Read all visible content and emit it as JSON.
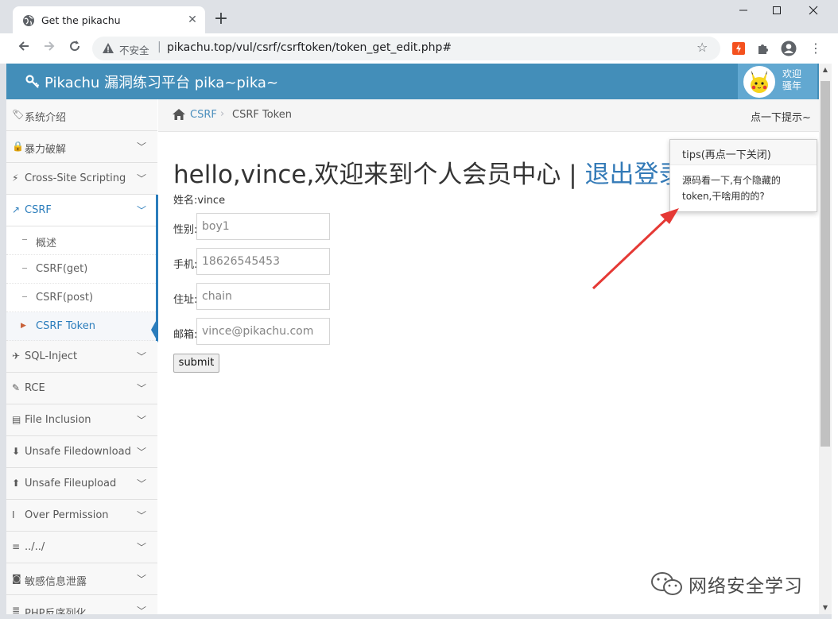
{
  "browser": {
    "tab_title": "Get the pikachu",
    "tab_close": "✕",
    "new_tab": "+",
    "insecure_label": "不安全",
    "url": "pikachu.top/vul/csrf/csrftoken/token_get_edit.php#"
  },
  "header": {
    "brand": "Pikachu 漏洞练习平台 pika~pika~",
    "welcome": "欢迎骚年"
  },
  "sidebar": {
    "items": [
      {
        "label": "系统介绍",
        "icon": "tags-icon",
        "glyph": "🏷"
      },
      {
        "label": "暴力破解",
        "icon": "lock-icon",
        "glyph": "🔒"
      },
      {
        "label": "Cross-Site Scripting",
        "icon": "xss-icon",
        "glyph": "⚡"
      },
      {
        "label": "CSRF",
        "icon": "share-icon",
        "glyph": "↗"
      },
      {
        "label": "SQL-Inject",
        "icon": "plane-icon",
        "glyph": "✈"
      },
      {
        "label": "RCE",
        "icon": "pencil-icon",
        "glyph": "✎"
      },
      {
        "label": "File Inclusion",
        "icon": "file-icon",
        "glyph": "▤"
      },
      {
        "label": "Unsafe Filedownload",
        "icon": "download-icon",
        "glyph": "⬇"
      },
      {
        "label": "Unsafe Fileupload",
        "icon": "upload-icon",
        "glyph": "⬆"
      },
      {
        "label": "Over Permission",
        "icon": "text-height-icon",
        "glyph": "I"
      },
      {
        "label": "../../",
        "icon": "align-left-icon",
        "glyph": "≡"
      },
      {
        "label": "敏感信息泄露",
        "icon": "camera-icon",
        "glyph": "◙"
      },
      {
        "label": "PHP反序列化",
        "icon": "list-icon",
        "glyph": "≣"
      }
    ],
    "csrf_sub": [
      "概述",
      "CSRF(get)",
      "CSRF(post)",
      "CSRF Token"
    ]
  },
  "breadcrumb": {
    "link": "CSRF",
    "separator": "›",
    "current": "CSRF Token",
    "hint": "点一下提示~"
  },
  "main": {
    "title_prefix": "hello,vince,欢迎来到个人会员中心 | ",
    "title_logout": "退出登录",
    "name_label": "姓名:vince",
    "fields": [
      {
        "label": "性别:",
        "value": "boy1"
      },
      {
        "label": "手机:",
        "value": "18626545453"
      },
      {
        "label": "住址:",
        "value": "chain"
      },
      {
        "label": "邮箱:",
        "value": "vince@pikachu.com"
      }
    ],
    "submit": "submit"
  },
  "popover": {
    "title": "tips(再点一下关闭)",
    "body": "源码看一下,有个隐藏的token,干啥用的的?"
  },
  "watermark": {
    "text": "网络安全学习"
  },
  "colors": {
    "header_bg": "#438eb9",
    "accent": "#2b7dbc",
    "annotation_arrow": "#e53935"
  }
}
